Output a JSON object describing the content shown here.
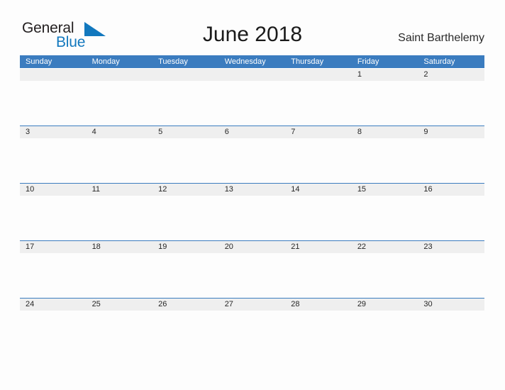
{
  "brand": {
    "word_one": "General",
    "word_two": "Blue",
    "flag_icon": "blue-flag-triangle",
    "color_dark": "#231f20",
    "color_blue": "#1278be"
  },
  "header": {
    "title": "June 2018",
    "location": "Saint Barthelemy"
  },
  "theme": {
    "header_blue": "#3b7cbf",
    "date_band_gray": "#efefef",
    "page_background": "#fdfdfd",
    "text_dark": "#262626",
    "header_text": "#ffffff"
  },
  "calendar": {
    "month": "June",
    "year": "2018",
    "weekdays": [
      "Sunday",
      "Monday",
      "Tuesday",
      "Wednesday",
      "Thursday",
      "Friday",
      "Saturday"
    ],
    "weeks": [
      [
        "",
        "",
        "",
        "",
        "",
        "1",
        "2"
      ],
      [
        "3",
        "4",
        "5",
        "6",
        "7",
        "8",
        "9"
      ],
      [
        "10",
        "11",
        "12",
        "13",
        "14",
        "15",
        "16"
      ],
      [
        "17",
        "18",
        "19",
        "20",
        "21",
        "22",
        "23"
      ],
      [
        "24",
        "25",
        "26",
        "27",
        "28",
        "29",
        "30"
      ]
    ]
  }
}
